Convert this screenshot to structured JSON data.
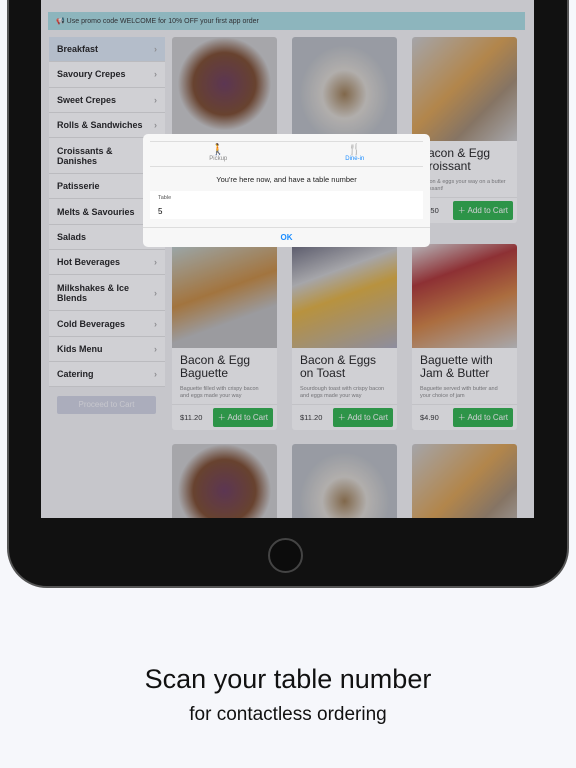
{
  "promo": "Use promo code WELCOME for 10% OFF your first app order",
  "categories": [
    "Breakfast",
    "Savoury Crepes",
    "Sweet Crepes",
    "Rolls & Sandwiches",
    "Croissants & Danishes",
    "Patisserie",
    "Melts & Savouries",
    "Salads",
    "Hot Beverages",
    "Milkshakes & Ice Blends",
    "Cold Beverages",
    "Kids Menu",
    "Catering"
  ],
  "proceed": "Proceed to Cart",
  "add_label": "Add to Cart",
  "products": [
    {
      "title": "",
      "desc": "",
      "price": ""
    },
    {
      "title": "",
      "desc": "",
      "price": ""
    },
    {
      "title": "Bacon & Egg Croissant",
      "desc": "Bacon & eggs your way on a butter croissant!",
      "price": "$8.50"
    },
    {
      "title": "Bacon & Egg Baguette",
      "desc": "Baguette filled with crispy bacon and eggs made your way",
      "price": "$11.20"
    },
    {
      "title": "Bacon & Eggs on Toast",
      "desc": "Sourdough toast with crispy bacon and eggs made your way",
      "price": "$11.20"
    },
    {
      "title": "Baguette with Jam & Butter",
      "desc": "Baguette served with butter and your choice of jam",
      "price": "$4.90"
    }
  ],
  "modal": {
    "tabs": [
      "Pickup",
      "Dine-in"
    ],
    "active_tab": "Dine-in",
    "message": "You're here now, and have a table number",
    "field_label": "Table",
    "field_value": "5",
    "ok": "OK"
  },
  "caption": {
    "title": "Scan your table number",
    "subtitle": "for contactless ordering"
  },
  "colors": {
    "accent": "#1a8cff",
    "add_button": "#2fb24c",
    "promo_bg": "#a9dde2"
  }
}
